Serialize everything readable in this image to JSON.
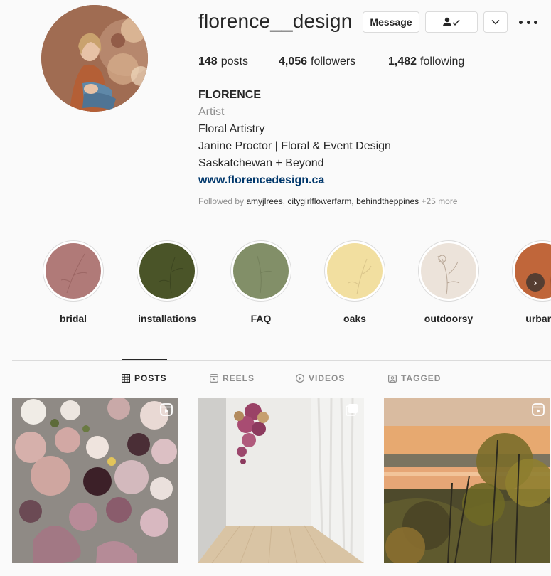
{
  "profile": {
    "username": "florence__design",
    "buttons": {
      "message": "Message",
      "follow_state_icon": "person-check-icon",
      "suggest_icon": "chevron-down-icon",
      "more_icon": "more-options-icon"
    },
    "stats": {
      "posts_count": "148",
      "posts_label": "posts",
      "followers_count": "4,056",
      "followers_label": "followers",
      "following_count": "1,482",
      "following_label": "following"
    },
    "bio": {
      "full_name": "FLORENCE",
      "category": "Artist",
      "lines": [
        "Floral Artistry",
        "Janine Proctor | Floral & Event Design",
        "Saskatchewan + Beyond"
      ],
      "website": "www.florencedesign.ca"
    },
    "followed_by": {
      "prefix": "Followed by",
      "names": "amyjlrees, citygirlflowerfarm, behindtheppines",
      "more": "+25 more"
    }
  },
  "highlights": [
    {
      "label": "bridal",
      "color": "#b07a78"
    },
    {
      "label": "installations",
      "color": "#4a5428"
    },
    {
      "label": "FAQ",
      "color": "#828f68"
    },
    {
      "label": "oaks",
      "color": "#f2dfa0"
    },
    {
      "label": "outdoorsy",
      "color": "#ece3da"
    },
    {
      "label": "urban f",
      "color": "#c0663a"
    }
  ],
  "tabs": [
    {
      "label": "POSTS",
      "icon": "grid-icon",
      "active": true
    },
    {
      "label": "REELS",
      "icon": "reels-icon",
      "active": false
    },
    {
      "label": "VIDEOS",
      "icon": "play-icon",
      "active": false
    },
    {
      "label": "TAGGED",
      "icon": "tagged-icon",
      "active": false
    }
  ],
  "posts": [
    {
      "badge_icon": "reel-icon"
    },
    {
      "badge_icon": "carousel-icon"
    },
    {
      "badge_icon": "reel-icon"
    }
  ],
  "colors": {
    "link": "#00376b",
    "muted": "#8e8e8e",
    "text": "#262626",
    "border": "#dbdbdb"
  }
}
